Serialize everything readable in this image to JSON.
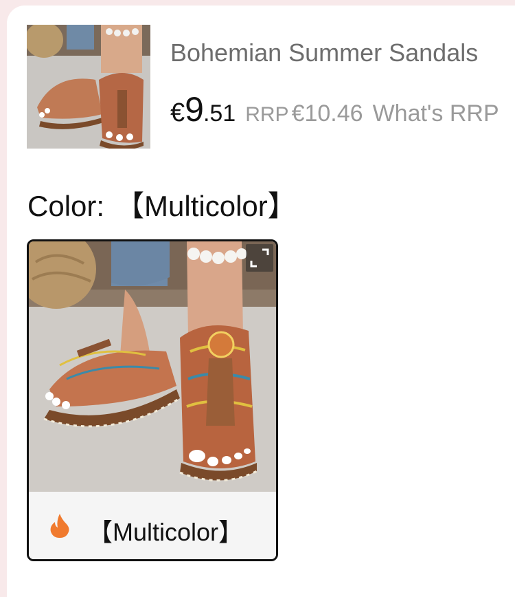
{
  "product": {
    "title": "Bohemian Summer Sandals",
    "thumbnail": "sandals-thumbnail-image"
  },
  "price": {
    "currency": "€",
    "main": "9",
    "cents": ".51",
    "rrp_label": "RRP",
    "rrp_value": "€10.46",
    "whats_rrp": "What's RRP"
  },
  "color": {
    "label": "Color:",
    "selected": "【Multicolor】"
  },
  "variants": [
    {
      "label": "【Multicolor】",
      "icon": "flame-icon",
      "image": "sandals-variant-image",
      "expand_icon": "expand-icon"
    }
  ],
  "colors": {
    "background": "#f8e9ea",
    "text": "#111111",
    "muted": "#9a9a9a",
    "title": "#6d6d6d",
    "flame": "#f07a2e",
    "card_border": "#111111"
  }
}
